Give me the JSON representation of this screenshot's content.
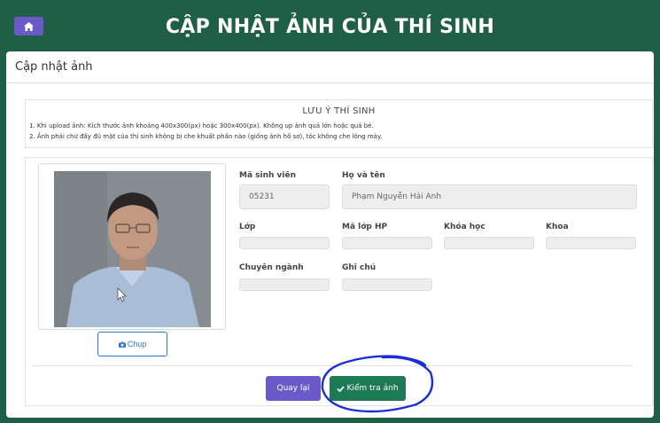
{
  "header": {
    "title": "CẬP NHẬT ẢNH CỦA THÍ SINH",
    "home_icon": "home-icon"
  },
  "card": {
    "title": "Cập nhật ảnh"
  },
  "notice": {
    "title": "LƯU Ý THÍ SINH",
    "lines": [
      "1. Khi upload ảnh: Kích thước ảnh khoảng 400x300(px) hoặc 300x400(px). Không up ảnh quá lớn hoặc quá bé.",
      "2. Ảnh phải chứ đầy đủ mặt của thí sinh không bị che khuất phần nào (giống ảnh hồ sơ), tóc không che lông mày."
    ]
  },
  "photo": {
    "capture_label": "Chụp",
    "capture_icon": "camera-icon"
  },
  "form": {
    "student_id_label": "Mã sinh viên",
    "student_id_value": "05231",
    "full_name_label": "Họ và tên",
    "full_name_value": "Phạm Nguyễn Hải Anh",
    "class_label": "Lớp",
    "class_value": "",
    "course_class_label": "Mã lớp HP",
    "course_class_value": "",
    "intake_label": "Khóa học",
    "intake_value": "",
    "faculty_label": "Khoa",
    "faculty_value": "",
    "major_label": "Chuyên ngành",
    "major_value": "",
    "note_label": "Ghi chú",
    "note_value": ""
  },
  "actions": {
    "back_label": "Quay lại",
    "check_label": "Kiểm tra ảnh",
    "check_icon": "check-icon"
  },
  "colors": {
    "header_bg": "#1e5f45",
    "primary_purple": "#6a5ac8",
    "primary_green": "#1e7a55",
    "link_blue": "#2f76c9",
    "annotation_ink": "#1b2fd6"
  }
}
